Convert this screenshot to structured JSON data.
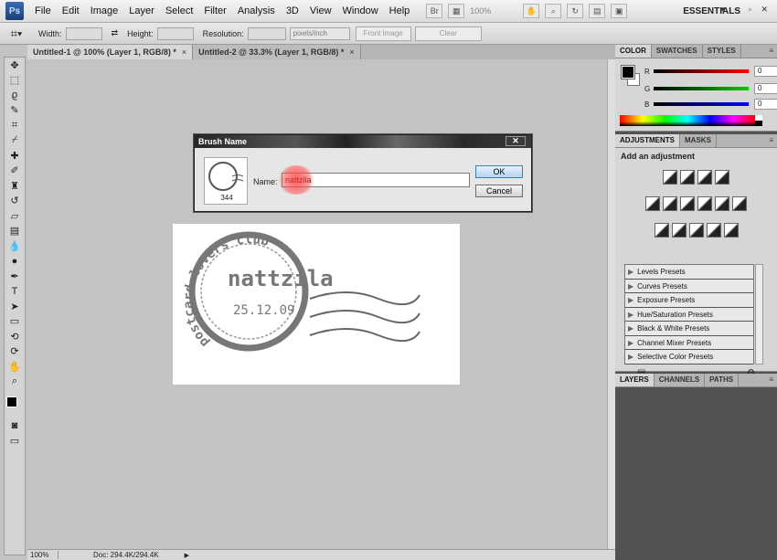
{
  "app": {
    "logo": "Ps",
    "workspace": "ESSENTIALS",
    "zoom_readout": "100%"
  },
  "menu": [
    "File",
    "Edit",
    "Image",
    "Layer",
    "Select",
    "Filter",
    "Analysis",
    "3D",
    "View",
    "Window",
    "Help"
  ],
  "options": {
    "width_label": "Width:",
    "height_label": "Height:",
    "resolution_label": "Resolution:",
    "units": "pixels/inch",
    "front_image": "Front Image",
    "clear": "Clear"
  },
  "tabs": [
    {
      "label": "Untitled-1 @ 100% (Layer 1, RGB/8) *"
    },
    {
      "label": "Untitled-2 @ 33.3% (Layer 1, RGB/8) *"
    }
  ],
  "status": {
    "zoom": "100%",
    "doc": "Doc: 294.4K/294.4K"
  },
  "panels": {
    "color_tabs": [
      "COLOR",
      "SWATCHES",
      "STYLES"
    ],
    "sliders": [
      {
        "label": "R",
        "value": "0"
      },
      {
        "label": "G",
        "value": "0"
      },
      {
        "label": "B",
        "value": "0"
      }
    ],
    "adj_tabs": [
      "ADJUSTMENTS",
      "MASKS"
    ],
    "adj_title": "Add an adjustment",
    "presets": [
      "Levels Presets",
      "Curves Presets",
      "Exposure Presets",
      "Hue/Saturation Presets",
      "Black & White Presets",
      "Channel Mixer Presets",
      "Selective Color Presets"
    ],
    "layer_tabs": [
      "LAYERS",
      "CHANNELS",
      "PATHS"
    ]
  },
  "dialog": {
    "title": "Brush Name",
    "name_label": "Name:",
    "name_value": "nattzila",
    "brush_size": "344",
    "ok": "OK",
    "cancel": "Cancel"
  },
  "canvas": {
    "stamp_text": "nattzila",
    "arc_text": "postcard lovers club",
    "date": "25.12.09"
  },
  "colors": {
    "foreground": "#000000",
    "background": "#ffffff",
    "highlight": "#ff3c3c"
  }
}
